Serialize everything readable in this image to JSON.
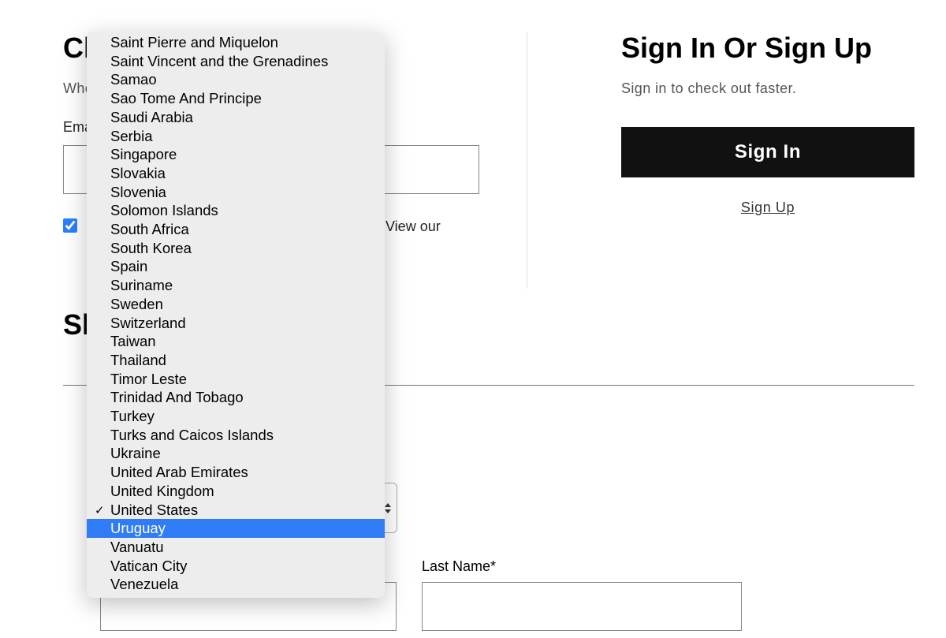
{
  "checkout": {
    "heading_partial": "Ch",
    "subtext_partial": "Whe",
    "email_label": "Ema",
    "checkbox_text_end": "s. View our"
  },
  "shipping": {
    "heading_partial": "Sh",
    "last_name_label": "Last Name*"
  },
  "auth": {
    "heading": "Sign In Or Sign Up",
    "subtext": "Sign in to check out faster.",
    "signin_button": "Sign In",
    "signup_link": "Sign Up"
  },
  "dropdown": {
    "selected": "United States",
    "highlighted": "Uruguay",
    "items": [
      {
        "label": "Saint Pierre and Miquelon"
      },
      {
        "label": "Saint Vincent and the Grenadines"
      },
      {
        "label": "Samao"
      },
      {
        "label": "Sao Tome And Principe"
      },
      {
        "label": "Saudi Arabia"
      },
      {
        "label": "Serbia"
      },
      {
        "label": "Singapore"
      },
      {
        "label": "Slovakia"
      },
      {
        "label": "Slovenia"
      },
      {
        "label": "Solomon Islands"
      },
      {
        "label": "South Africa"
      },
      {
        "label": "South Korea"
      },
      {
        "label": "Spain"
      },
      {
        "label": "Suriname"
      },
      {
        "label": "Sweden"
      },
      {
        "label": "Switzerland"
      },
      {
        "label": "Taiwan"
      },
      {
        "label": "Thailand"
      },
      {
        "label": "Timor Leste"
      },
      {
        "label": "Trinidad And Tobago"
      },
      {
        "label": "Turkey"
      },
      {
        "label": "Turks and Caicos Islands"
      },
      {
        "label": "Ukraine"
      },
      {
        "label": "United Arab Emirates"
      },
      {
        "label": "United Kingdom"
      },
      {
        "label": "United States",
        "selected": true
      },
      {
        "label": "Uruguay",
        "highlighted": true
      },
      {
        "label": "Vanuatu"
      },
      {
        "label": "Vatican City"
      },
      {
        "label": "Venezuela"
      }
    ]
  }
}
